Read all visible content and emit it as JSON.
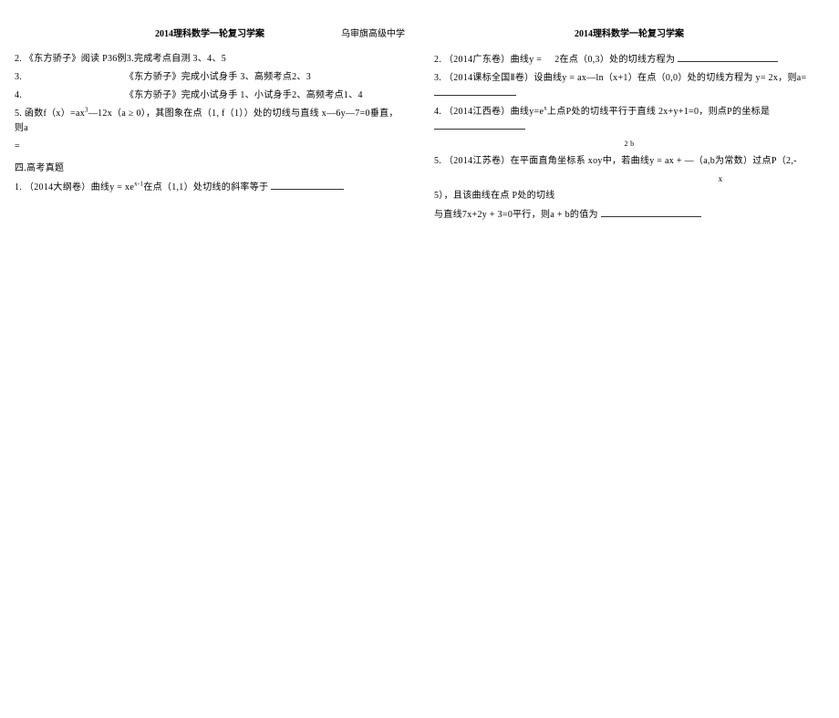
{
  "header_left_title": "2014理科数学一轮复习学案",
  "header_school": "乌审旗高级中学",
  "header_right_title": "2014理科数学一轮复习学案",
  "left": {
    "item2": "2. 《东方骄子》阅读 P36例3.完成考点自测 3、4、5",
    "item3": "3.",
    "item3b": "《东方骄子》完成小试身手  3、高频考点2、3",
    "item4": "4.",
    "item4b": "《东方骄子》完成小试身手  1、小试身手2、高频考点1、4",
    "item5_prefix": "5. 函数f（x）=ax",
    "item5_sup": "3",
    "item5_mid": "—12x（a ≥ 0），其图象在点（1, f（1））处的切线与直线 x—6y—7=0垂直，则a",
    "item5_end": "=",
    "section4_title": "四.高考真题",
    "q1_prefix": "1. （2014大纲卷）曲线y = xe",
    "q1_sup": "x-1",
    "q1_mid": "在点（1,1）处切线的斜率等于"
  },
  "right": {
    "q2_prefix": "2. （2014广东卷）曲线y =",
    "q2_mid": "2在点（0,3）处的切线方程为",
    "q3": "3. （2014课标全国Ⅱ卷）设曲线y = ax—ln（x+1）在点（0,0）处的切线方程为 y= 2x，则a=",
    "q4_prefix": "4. （2014江西卷）曲线y=e",
    "q4_sup": "x",
    "q4_mid": "上点P处的切线平行于直线 2x+y+1=0，则点P的坐标是",
    "q4_annot": "2 b",
    "q5_line1": "5. （2014江苏卷）在平面直角坐标系 xoy中，若曲线y = ax + —（a,b为常数）过点P（2,-",
    "q5_annot": "x",
    "q5_line2": "5），且该曲线在点 P处的切线",
    "q5_line3": "与直线7x+2y + 3=0平行，则a + b的值为"
  }
}
